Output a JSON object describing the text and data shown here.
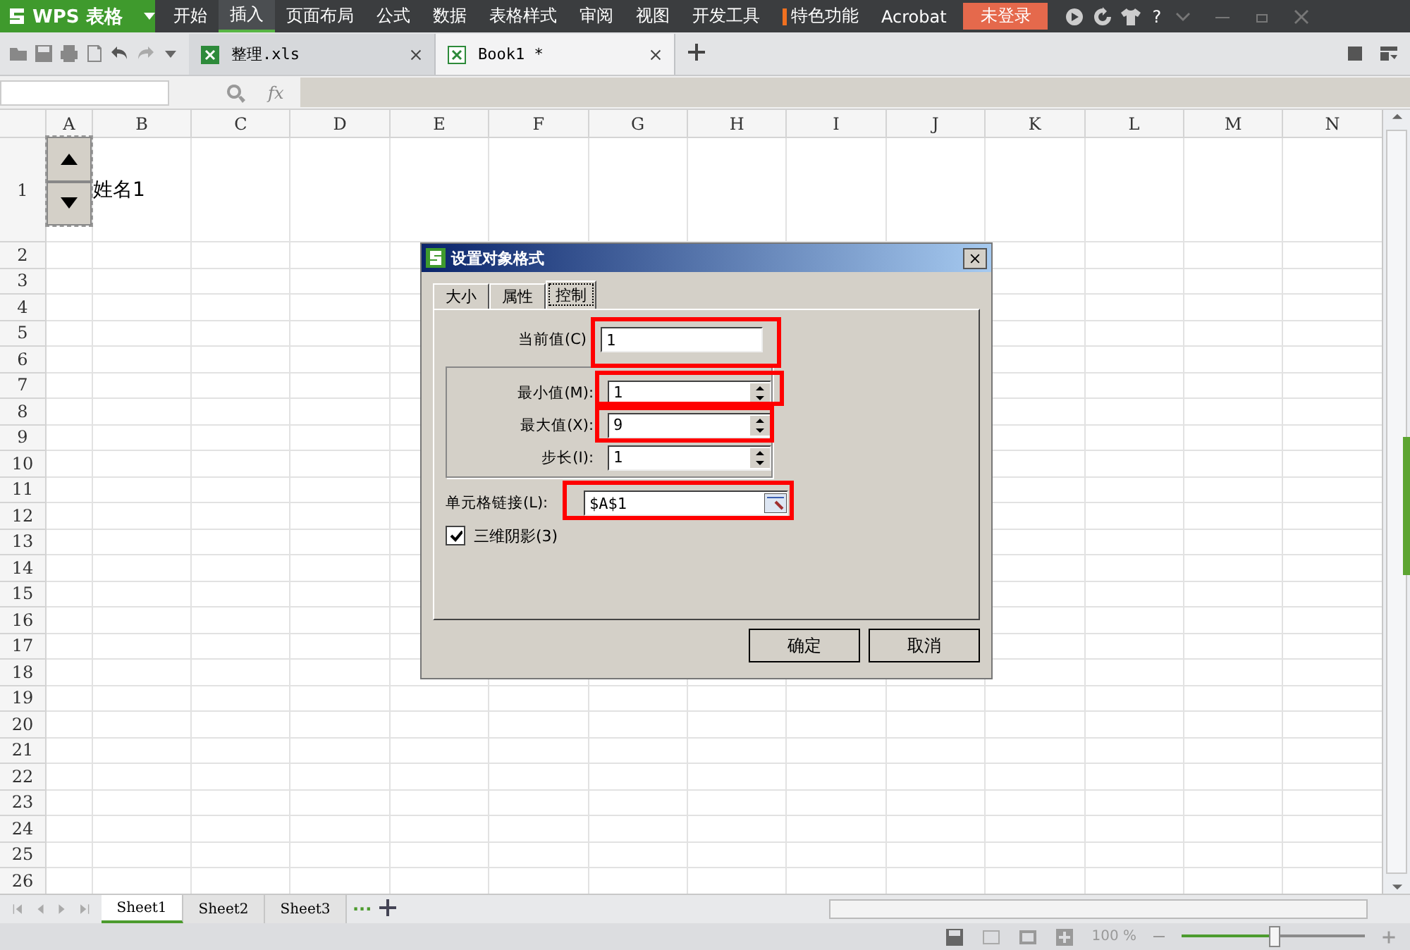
{
  "menu_bar": {
    "app_label": "WPS 表格",
    "items": [
      {
        "label": "开始",
        "selected": false
      },
      {
        "label": "插入",
        "selected": true
      },
      {
        "label": "页面布局",
        "selected": false
      },
      {
        "label": "公式",
        "selected": false
      },
      {
        "label": "数据",
        "selected": false
      },
      {
        "label": "表格样式",
        "selected": false
      },
      {
        "label": "审阅",
        "selected": false
      },
      {
        "label": "视图",
        "selected": false
      },
      {
        "label": "开发工具",
        "selected": false
      },
      {
        "label": "特色功能",
        "selected": false,
        "marked": true
      },
      {
        "label": "Acrobat",
        "selected": false
      }
    ],
    "login": "未登录",
    "help": "?"
  },
  "doc_tabs": [
    {
      "label": "整理.xls",
      "selected": false
    },
    {
      "label": "Book1 *",
      "selected": true
    }
  ],
  "formula_bar": {
    "fx": "fx"
  },
  "columns": [
    "A",
    "B",
    "C",
    "D",
    "E",
    "F",
    "G",
    "H",
    "I",
    "J",
    "K",
    "L",
    "M",
    "N"
  ],
  "rows": [
    "1",
    "2",
    "3",
    "4",
    "5",
    "6",
    "7",
    "8",
    "9",
    "10",
    "11",
    "12",
    "13",
    "14",
    "15",
    "16",
    "17",
    "18",
    "19",
    "20",
    "21",
    "22",
    "23",
    "24",
    "25",
    "26"
  ],
  "cell_b1": "姓名1",
  "dialog": {
    "title": "设置对象格式",
    "tabs": [
      {
        "label": "大小",
        "selected": false
      },
      {
        "label": "属性",
        "selected": false
      },
      {
        "label": "控制",
        "selected": true
      }
    ],
    "current_value": {
      "label": "当前值(C)",
      "value": "1"
    },
    "spin_fields": [
      {
        "label": "最小值(M):",
        "value": "1"
      },
      {
        "label": "最大值(X):",
        "value": "9"
      },
      {
        "label": "步长(I):",
        "value": "1"
      }
    ],
    "cell_link": {
      "label": "单元格链接(L):",
      "value": "$A$1"
    },
    "shading": {
      "label": "三维阴影(3)",
      "checked": true
    },
    "buttons": [
      "确定",
      "取消"
    ]
  },
  "sheet_tabs": [
    {
      "label": "Sheet1",
      "selected": true
    },
    {
      "label": "Sheet2",
      "selected": false
    },
    {
      "label": "Sheet3",
      "selected": false
    }
  ],
  "sheet_more": "···",
  "status_bar": {
    "zoom": "100 %",
    "zoom_level": {
      "level": 0.5
    }
  }
}
